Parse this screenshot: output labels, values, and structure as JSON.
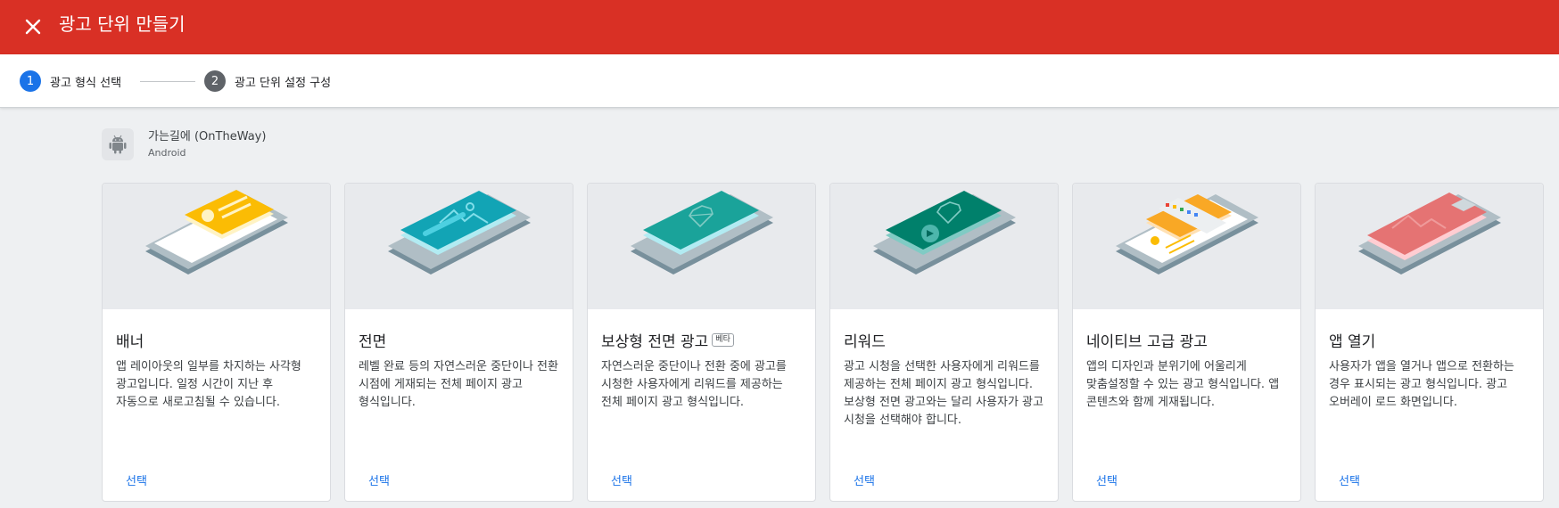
{
  "header": {
    "title": "광고 단위 만들기",
    "close_icon": "close-icon"
  },
  "stepper": {
    "steps": [
      {
        "number": "1",
        "label": "광고 형식 선택",
        "state": "active"
      },
      {
        "number": "2",
        "label": "광고 단위 설정 구성",
        "state": "inactive"
      }
    ]
  },
  "app": {
    "name": "가는길에 (OnTheWay)",
    "platform": "Android",
    "icon": "android-icon"
  },
  "formats": [
    {
      "title": "배너",
      "badge": "",
      "description": "앱 레이아웃의 일부를 차지하는 사각형 광고입니다. 일정 시간이 지난 후 자동으로 새로고침될 수 있습니다.",
      "select_label": "선택"
    },
    {
      "title": "전면",
      "badge": "",
      "description": "레벨 완료 등의 자연스러운 중단이나 전환 시점에 게재되는 전체 페이지 광고 형식입니다.",
      "select_label": "선택"
    },
    {
      "title": "보상형 전면 광고",
      "badge": "베타",
      "description": "자연스러운 중단이나 전환 중에 광고를 시청한 사용자에게 리워드를 제공하는 전체 페이지 광고 형식입니다.",
      "select_label": "선택"
    },
    {
      "title": "리워드",
      "badge": "",
      "description": "광고 시청을 선택한 사용자에게 리워드를 제공하는 전체 페이지 광고 형식입니다. 보상형 전면 광고와는 달리 사용자가 광고 시청을 선택해야 합니다.",
      "select_label": "선택"
    },
    {
      "title": "네이티브 고급 광고",
      "badge": "",
      "description": "앱의 디자인과 분위기에 어울리게 맞춤설정할 수 있는 광고 형식입니다. 앱 콘텐츠와 함께 게재됩니다.",
      "select_label": "선택"
    },
    {
      "title": "앱 열기",
      "badge": "",
      "description": "사용자가 앱을 열거나 앱으로 전환하는 경우 표시되는 광고 형식입니다. 광고 오버레이 로드 화면입니다.",
      "select_label": "선택"
    }
  ],
  "colors": {
    "header_bg": "#d93025",
    "step_active": "#1a73e8",
    "step_inactive": "#5f6368",
    "link": "#1a73e8",
    "banner": "#fbbc04",
    "interstitial": "#12a4b5",
    "rewarded_interstitial": "#1aa39a",
    "rewarded": "#00806b",
    "native": "#f9a825",
    "app_open": "#e57373"
  }
}
